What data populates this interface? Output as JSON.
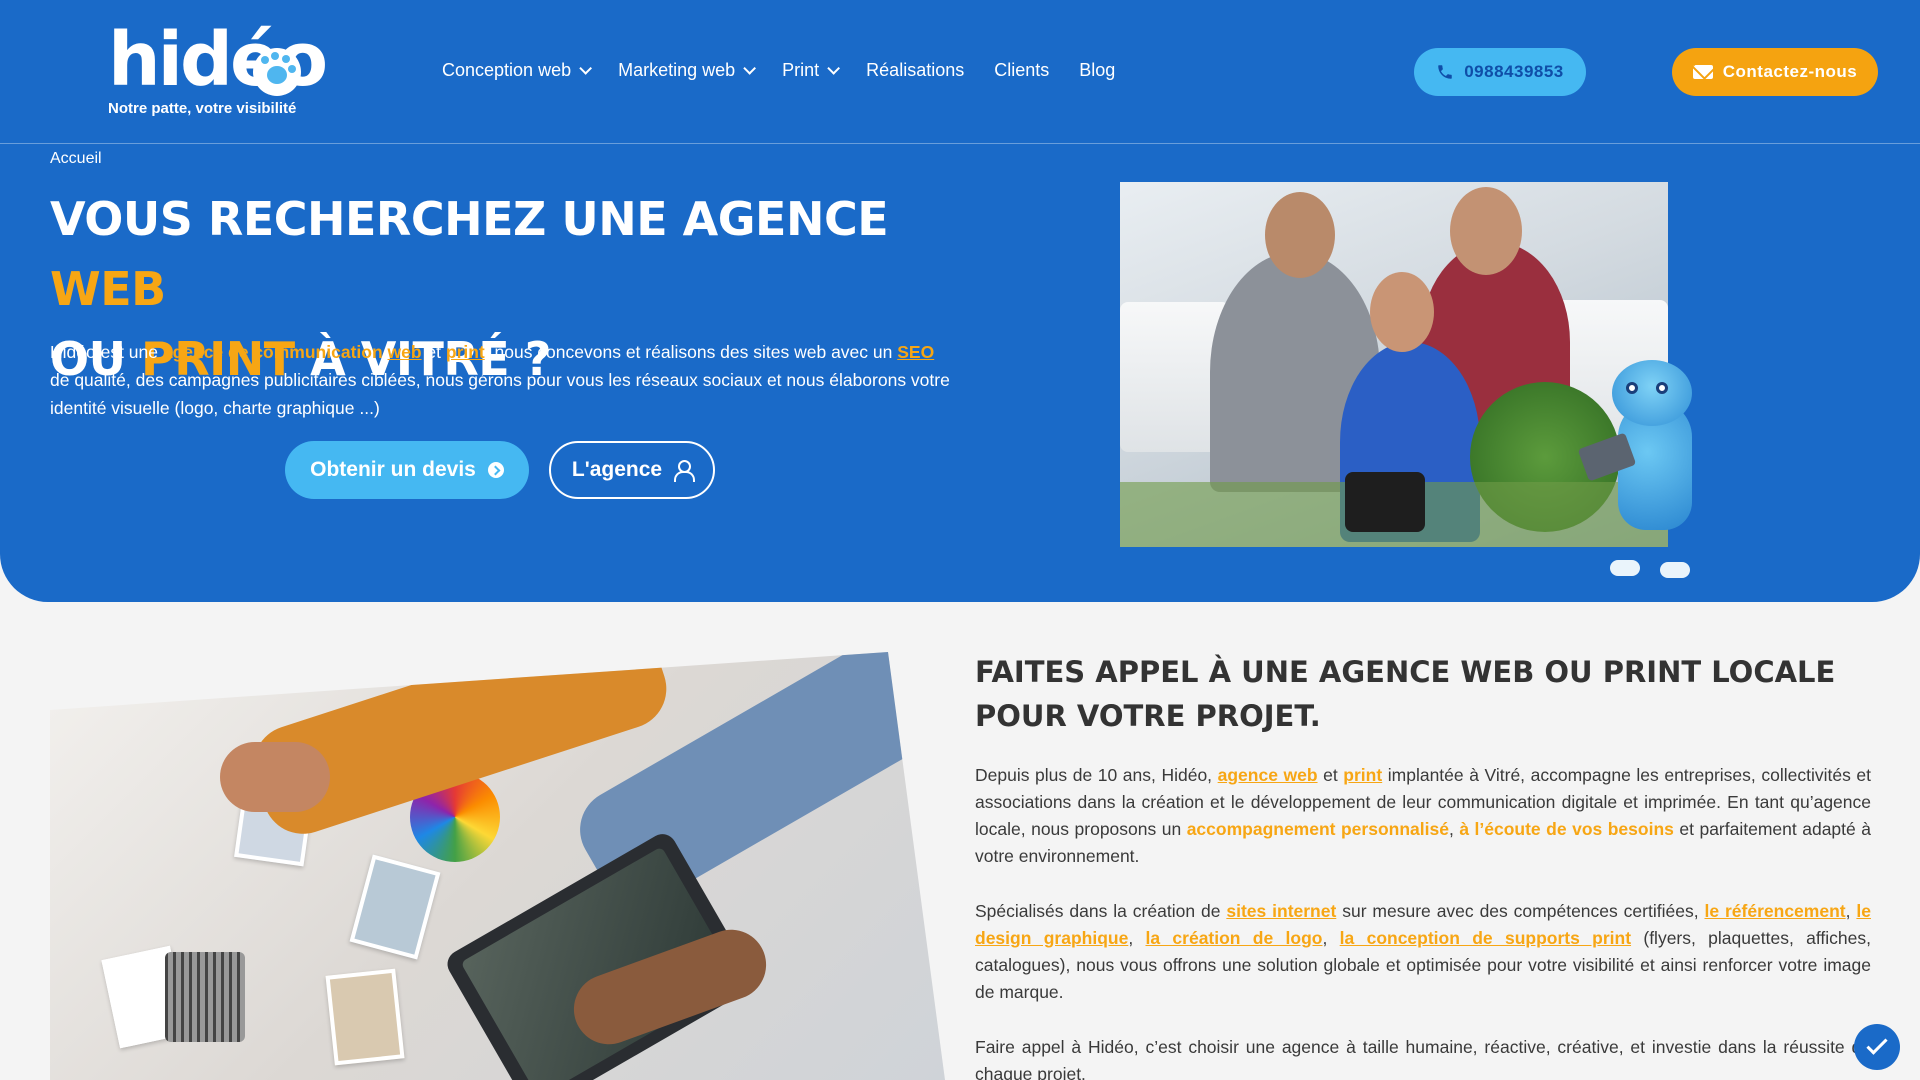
{
  "header": {
    "logo_text": "hidéo",
    "tagline": "Notre patte, votre visibilité",
    "nav": [
      {
        "label": "Conception web",
        "dropdown": true
      },
      {
        "label": "Marketing web",
        "dropdown": true
      },
      {
        "label": "Print",
        "dropdown": true
      },
      {
        "label": "Réalisations",
        "dropdown": false
      },
      {
        "label": "Clients",
        "dropdown": false
      },
      {
        "label": "Blog",
        "dropdown": false
      }
    ],
    "phone": "0988439853",
    "contact_label": "Contactez-nous"
  },
  "breadcrumb": "Accueil",
  "hero": {
    "title_1": "Vous recherchez une agence ",
    "title_accent_1": "web",
    "title_2": "ou ",
    "title_accent_2": "print",
    "title_3": " à Vitré ?",
    "text_1": "Hidéo est une ",
    "link_1": "agence de communication ",
    "link_2": "web",
    "text_2": " et ",
    "link_3": "print",
    "text_3": ", nous concevons et réalisons des sites web avec un ",
    "link_4": "SEO",
    "text_4": " de qualité, des campagnes publicitaires ciblées, nous gérons pour vous les réseaux sociaux et nous élaborons votre identité visuelle (logo, charte graphique ...)",
    "btn_quote": "Obtenir un devis",
    "btn_agency": "L'agence"
  },
  "section": {
    "title": "Faites appel à une agence web ou print locale pour votre projet.",
    "p1_a": "Depuis plus de 10 ans, Hidéo, ",
    "p1_l1": "agence web",
    "p1_b": " et ",
    "p1_l2": "print",
    "p1_c": " implantée à Vitré, accompagne les entreprises, collectivités et associations dans la création et le développement de leur communication digitale et imprimée. En tant qu’agence locale, nous proposons un ",
    "p1_h1": "accompagnement personnalisé",
    "p1_d": ", ",
    "p1_h2": "à l’écoute de vos besoins",
    "p1_e": " et parfaitement adapté à votre environnement.",
    "p2_a": "Spécialisés dans la création de ",
    "p2_l1": "sites internet",
    "p2_b": " sur mesure avec des compétences certifiées, ",
    "p2_l2": "le référencement",
    "p2_c": ", ",
    "p2_l3": "le design graphique",
    "p2_d": ", ",
    "p2_l4": "la création de logo",
    "p2_e": ", ",
    "p2_l5": "la conception de supports print",
    "p2_f": " (flyers, plaquettes, affiches, catalogues), nous vous offrons une solution globale et optimisée pour votre visibilité et ainsi renforcer votre image de marque.",
    "p3": "Faire appel à Hidéo, c’est choisir une agence à taille humaine, réactive, créative, et investie dans la réussite de chaque projet."
  },
  "colors": {
    "primary": "#1a6ac8",
    "accent": "#f7a614",
    "light_blue": "#45b8f2"
  }
}
